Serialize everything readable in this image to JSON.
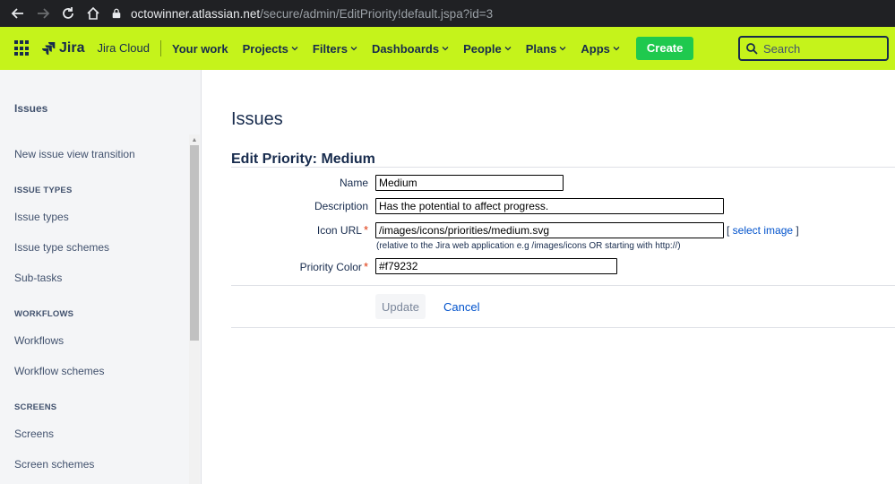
{
  "browser": {
    "url_host": "octowinner.atlassian.net",
    "url_path": "/secure/admin/EditPriority!default.jspa?id=3"
  },
  "topnav": {
    "logo_text": "Jira",
    "product": "Jira Cloud",
    "menu": [
      {
        "label": "Your work",
        "has_dropdown": false
      },
      {
        "label": "Projects",
        "has_dropdown": true
      },
      {
        "label": "Filters",
        "has_dropdown": true
      },
      {
        "label": "Dashboards",
        "has_dropdown": true
      },
      {
        "label": "People",
        "has_dropdown": true
      },
      {
        "label": "Plans",
        "has_dropdown": true
      },
      {
        "label": "Apps",
        "has_dropdown": true
      }
    ],
    "create_label": "Create",
    "search_placeholder": "Search",
    "accent_color": "#c5f31b"
  },
  "sidebar": {
    "title": "Issues",
    "items": [
      {
        "type": "item",
        "label": "New issue view transition"
      },
      {
        "type": "heading",
        "label": "ISSUE TYPES"
      },
      {
        "type": "item",
        "label": "Issue types"
      },
      {
        "type": "item",
        "label": "Issue type schemes"
      },
      {
        "type": "item",
        "label": "Sub-tasks"
      },
      {
        "type": "heading",
        "label": "WORKFLOWS"
      },
      {
        "type": "item",
        "label": "Workflows"
      },
      {
        "type": "item",
        "label": "Workflow schemes"
      },
      {
        "type": "heading",
        "label": "SCREENS"
      },
      {
        "type": "item",
        "label": "Screens"
      },
      {
        "type": "item",
        "label": "Screen schemes"
      }
    ]
  },
  "main": {
    "page_title": "Issues",
    "form_title": "Edit Priority: Medium",
    "fields": {
      "name_label": "Name",
      "name_value": "Medium",
      "description_label": "Description",
      "description_value": "Has the potential to affect progress.",
      "icon_url_label": "Icon URL",
      "icon_url_value": "/images/icons/priorities/medium.svg",
      "select_image_label": "select image",
      "icon_url_hint": "(relative to the Jira web application e.g /images/icons OR starting with http://)",
      "priority_color_label": "Priority Color",
      "priority_color_value": "#f79232"
    },
    "update_label": "Update",
    "cancel_label": "Cancel"
  }
}
